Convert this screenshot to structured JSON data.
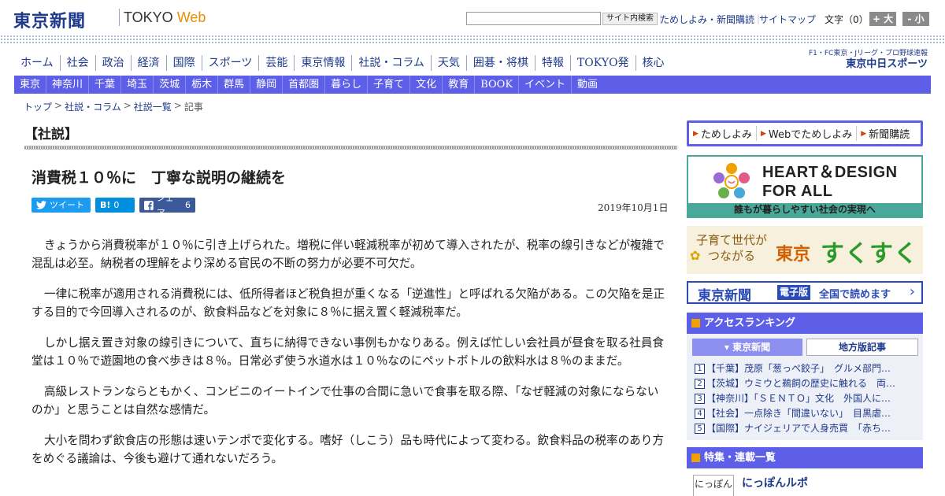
{
  "header": {
    "logo": "東京新聞",
    "logo_sub_a": "TOKYO ",
    "logo_sub_b": "Web",
    "search_button": "サイト内検索",
    "link_trial": "ためしよみ・新聞購読",
    "link_sitemap": "サイトマップ",
    "font_size_label": "文字（0）",
    "font_plus": "+ 大",
    "font_minus": "- 小",
    "sep": "｜"
  },
  "nav_main": [
    "ホーム",
    "社会",
    "政治",
    "経済",
    "国際",
    "スポーツ",
    "芸能",
    "東京情報",
    "社説・コラム",
    "天気",
    "囲碁・将棋",
    "特報",
    "TOKYO発",
    "核心"
  ],
  "chunichi": {
    "top": "F1・FC東京・Jリーグ・プロ野球速報",
    "brand": "東京中日スポーツ"
  },
  "nav_region": [
    "東京",
    "神奈川",
    "千葉",
    "埼玉",
    "茨城",
    "栃木",
    "群馬",
    "静岡",
    "首都圏",
    "暮らし",
    "子育て",
    "文化",
    "教育",
    "BOOK",
    "イベント",
    "動画"
  ],
  "breadcrumb": [
    "トップ",
    "社説・コラム",
    "社説一覧",
    "記事"
  ],
  "breadcrumb_sep": ">",
  "article": {
    "section": "【社説】",
    "headline": "消費税１０％に　丁寧な説明の継続を",
    "tweet": "ツイート",
    "hatena_label": "B!",
    "hatena_count": "0",
    "fb_label": "シェア",
    "fb_count": "6",
    "date": "2019年10月1日",
    "paragraphs": [
      "きょうから消費税率が１０％に引き上げられた。増税に伴い軽減税率が初めて導入されたが、税率の線引きなどが複雑で混乱は必至。納税者の理解をより深める官民の不断の努力が必要不可欠だ。",
      "一律に税率が適用される消費税には、低所得者ほど税負担が重くなる「逆進性」と呼ばれる欠陥がある。この欠陥を是正する目的で今回導入されるのが、飲食料品などを対象に８％に据え置く軽減税率だ。",
      "しかし据え置き対象の線引きについて、直ちに納得できない事例もかなりある。例えば忙しい会社員が昼食を取る社員食堂は１０％で遊園地の食べ歩きは８％。日常必ず使う水道水は１０％なのにペットボトルの飲料水は８％のままだ。",
      "高級レストランならともかく、コンビニのイートインで仕事の合間に急いで食事を取る際、「なぜ軽減の対象にならないのか」と思うことは自然な感情だ。",
      "大小を問わず飲食店の形態は速いテンポで変化する。嗜好（しこう）品も時代によって変わる。飲食料品の税率のあり方をめぐる議論は、今後も避けて通れないだろう。"
    ]
  },
  "sidebar": {
    "subscribe": [
      "ためしよみ",
      "Webでためしよみ",
      "新聞購読"
    ],
    "heart_title_1": "HEART＆DESIGN",
    "heart_title_2": "FOR ALL",
    "heart_foot": "誰もが暮らしやすい社会の実現へ",
    "suku_left_1": "子育て世代が",
    "suku_left_2": "つながる",
    "suku_tokyo": "東京",
    "suku_main": "すくすく",
    "digital_brand": "東京新聞",
    "digital_tag": "電子版",
    "digital_text": "全国で読めます",
    "digital_arrow": "›",
    "ranking_title": "アクセスランキング",
    "ranking_tab_active": "▾ 東京新聞",
    "ranking_tab_other": "地方版記事",
    "ranking": [
      {
        "num": "1",
        "text": "【千葉】茂原「葱っぺ餃子」　グルメ部門…"
      },
      {
        "num": "2",
        "text": "【茨城】ウミウと鵜飼の歴史に触れる　両…"
      },
      {
        "num": "3",
        "text": "【神奈川】「ＳＥＮＴＯ」文化　外国人に…"
      },
      {
        "num": "4",
        "text": "【社会】一点除き「間違いない」　目黒虐…"
      },
      {
        "num": "5",
        "text": "【国際】ナイジェリアで人身売買　「赤ち…"
      }
    ],
    "feature_title": "特集・連載一覧",
    "feature_thumb": "にっぽん",
    "feature_item": "にっぽんルポ"
  },
  "colors": {
    "nav_blue": "#5d5fe8",
    "link_navy": "#1e3a8a",
    "accent_orange": "#f0a000",
    "heart_teal": "#4aa89a"
  }
}
